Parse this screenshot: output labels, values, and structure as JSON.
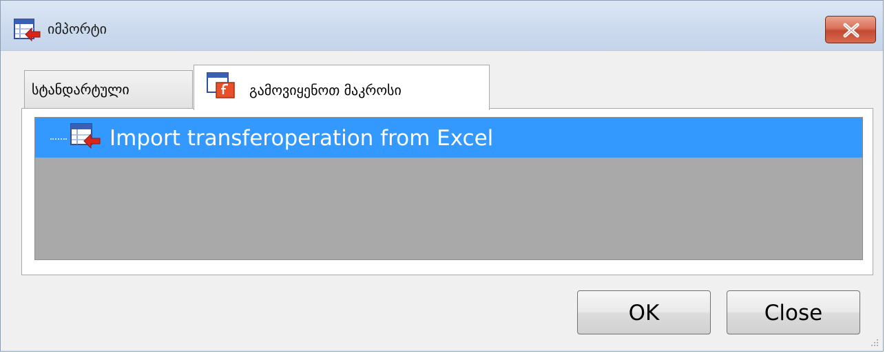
{
  "window": {
    "title": "იმპორტი",
    "title_icon": "import-table-icon",
    "close_icon": "close-x-icon"
  },
  "tabs": [
    {
      "label": "სტანდარტული",
      "active": false
    },
    {
      "label": "გამოვიყენოთ მაკროსი",
      "active": true,
      "icon": "macro-script-icon"
    }
  ],
  "tree": {
    "items": [
      {
        "label": "Import transferoperation from Excel",
        "selected": true,
        "icon": "import-table-icon"
      }
    ]
  },
  "buttons": {
    "ok_label": "OK",
    "close_label": "Close"
  },
  "colors": {
    "selection": "#3399ff",
    "tree_background": "#a9a9a9",
    "close_button": "#c34a33"
  }
}
